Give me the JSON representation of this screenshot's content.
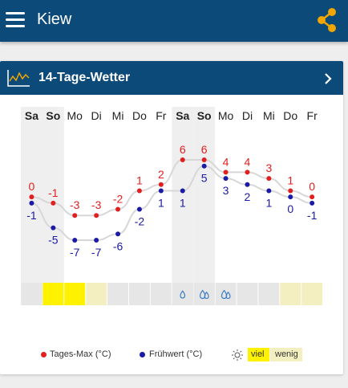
{
  "header": {
    "title": "Kiew",
    "menu_icon": "hamburger-menu-icon",
    "share_icon": "share-icon",
    "bg_color": "#0c4a7a"
  },
  "card": {
    "title": "14-Tage-Wetter",
    "icon": "line-chart-icon",
    "chevron_icon": "chevron-right-icon"
  },
  "chart_data": {
    "type": "line",
    "x": [
      "Sa",
      "So",
      "Mo",
      "Di",
      "Mi",
      "Do",
      "Fr",
      "Sa",
      "So",
      "Mo",
      "Di",
      "Mi",
      "Do",
      "Fr"
    ],
    "weekend_indices": [
      0,
      1,
      7,
      8
    ],
    "series": [
      {
        "name": "Tages-Max (°C)",
        "color": "#e02020",
        "values": [
          0,
          -1,
          -3,
          -3,
          -2,
          1,
          2,
          6,
          6,
          4,
          4,
          3,
          1,
          0
        ]
      },
      {
        "name": "Frühwert (°C)",
        "color": "#1a1aa6",
        "values": [
          -1,
          -5,
          -7,
          -7,
          -6,
          -2,
          1,
          1,
          5,
          3,
          2,
          1,
          0,
          -1
        ]
      }
    ],
    "ylim": [
      -7,
      6
    ],
    "sun": [
      "grau",
      "viel",
      "viel",
      "wenig",
      "grau",
      "grau",
      "grau",
      "grau",
      "grau",
      "grau",
      "grau",
      "grau",
      "wenig",
      "wenig"
    ],
    "precip": [
      false,
      false,
      false,
      false,
      false,
      false,
      false,
      "drop",
      "drops",
      "drops",
      false,
      false,
      false,
      false
    ],
    "grid": false
  },
  "legend": {
    "max_label": "Tages-Max (°C)",
    "min_label": "Frühwert (°C)",
    "sun_icon": "sun-icon",
    "viel": "viel",
    "wenig": "wenig"
  }
}
